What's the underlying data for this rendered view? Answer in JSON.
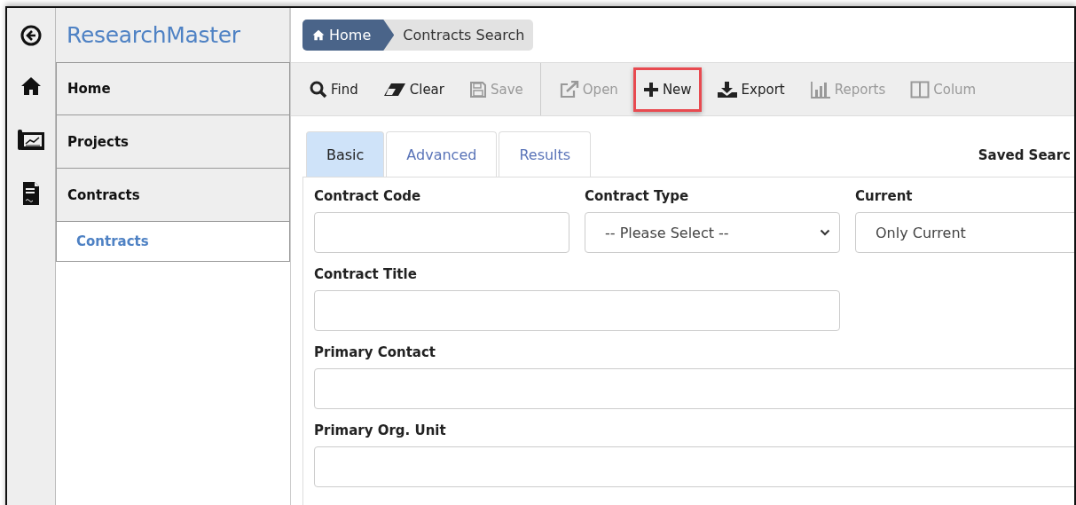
{
  "sidebar": {
    "app_title": "ResearchMaster",
    "items": [
      {
        "label": "Home",
        "selected": false
      },
      {
        "label": "Projects",
        "selected": false
      },
      {
        "label": "Contracts",
        "selected": false,
        "children": [
          {
            "label": "Contracts",
            "selected": true
          }
        ]
      }
    ]
  },
  "breadcrumb": [
    {
      "label": "Home",
      "kind": "home"
    },
    {
      "label": "Contracts Search",
      "kind": "current"
    }
  ],
  "toolbar": {
    "groups": [
      [
        {
          "label": "Find",
          "kind": "search",
          "disabled": false,
          "highlighted": false
        },
        {
          "label": "Clear",
          "kind": "eraser",
          "disabled": false,
          "highlighted": false
        },
        {
          "label": "Save",
          "kind": "save",
          "disabled": true,
          "highlighted": false
        }
      ],
      [
        {
          "label": "Open",
          "kind": "open",
          "disabled": true,
          "highlighted": false
        },
        {
          "label": "New",
          "kind": "plus",
          "disabled": false,
          "highlighted": true
        },
        {
          "label": "Export",
          "kind": "download",
          "disabled": false,
          "highlighted": false
        },
        {
          "label": "Reports",
          "kind": "chart",
          "disabled": true,
          "highlighted": false
        },
        {
          "label": "Colum",
          "kind": "columns",
          "disabled": true,
          "highlighted": false
        }
      ]
    ]
  },
  "tabs": [
    {
      "label": "Basic",
      "selected": true
    },
    {
      "label": "Advanced",
      "selected": false
    },
    {
      "label": "Results",
      "selected": false
    }
  ],
  "saved_searches_label": "Saved Searc",
  "form": {
    "rows": [
      [
        {
          "label": "Contract Code",
          "kind": "text"
        },
        {
          "label": "Contract Type",
          "kind": "select",
          "value": "-- Please Select --"
        },
        {
          "label": "Current",
          "kind": "select_cut",
          "value": "Only Current"
        }
      ],
      [
        {
          "label": "Contract Title",
          "kind": "text"
        }
      ],
      [
        {
          "label": "Primary Contact",
          "kind": "text"
        }
      ],
      [
        {
          "label": "Primary Org. Unit",
          "kind": "text"
        }
      ]
    ]
  }
}
